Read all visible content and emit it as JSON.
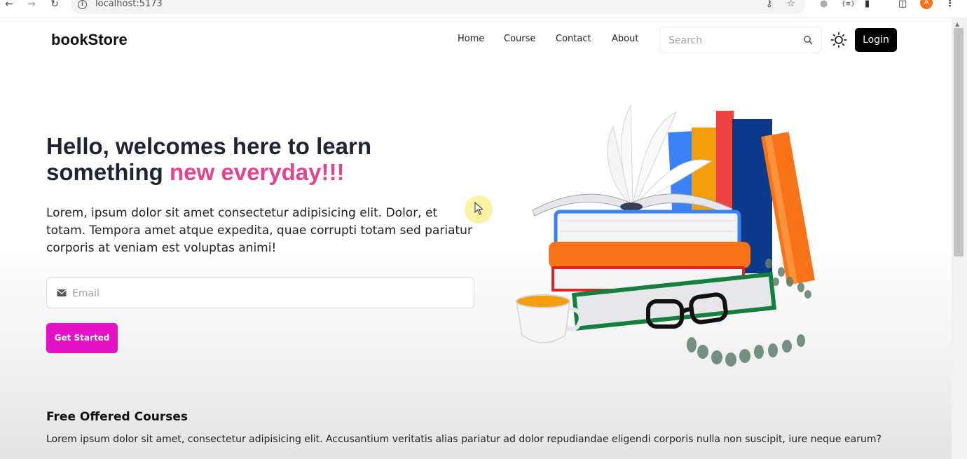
{
  "browser": {
    "url": "localhost:5173",
    "profile_initial": "A"
  },
  "nav": {
    "logo": "bookStore",
    "menu": [
      "Home",
      "Course",
      "Contact",
      "About"
    ],
    "search_placeholder": "Search",
    "login_label": "Login"
  },
  "hero": {
    "title_main": "Hello, welcomes here to learn something ",
    "title_accent": "new everyday!!!",
    "description": "Lorem, ipsum dolor sit amet consectetur adipisicing elit. Dolor, et totam. Tempora amet atque expedita, quae corrupti totam sed pariatur corporis at veniam est voluptas animi!",
    "email_placeholder": "Email",
    "cta_label": "Get Started"
  },
  "courses": {
    "title": "Free Offered Courses",
    "description": "Lorem ipsum dolor sit amet, consectetur adipisicing elit. Accusantium veritatis alias pariatur ad dolor repudiandae eligendi corporis nulla non suscipit, iure neque earum?"
  },
  "colors": {
    "accent_pink": "#e5428f",
    "cta_magenta": "#e411c7",
    "login_bg": "#000000"
  },
  "icons": [
    "back-arrow-icon",
    "forward-arrow-icon",
    "reload-icon",
    "site-info-icon",
    "password-key-icon",
    "bookmark-star-icon",
    "extension-icon",
    "puzzle-icon",
    "sidebar-icon",
    "menu-dots-icon",
    "search-icon",
    "sun-icon",
    "mail-icon"
  ]
}
